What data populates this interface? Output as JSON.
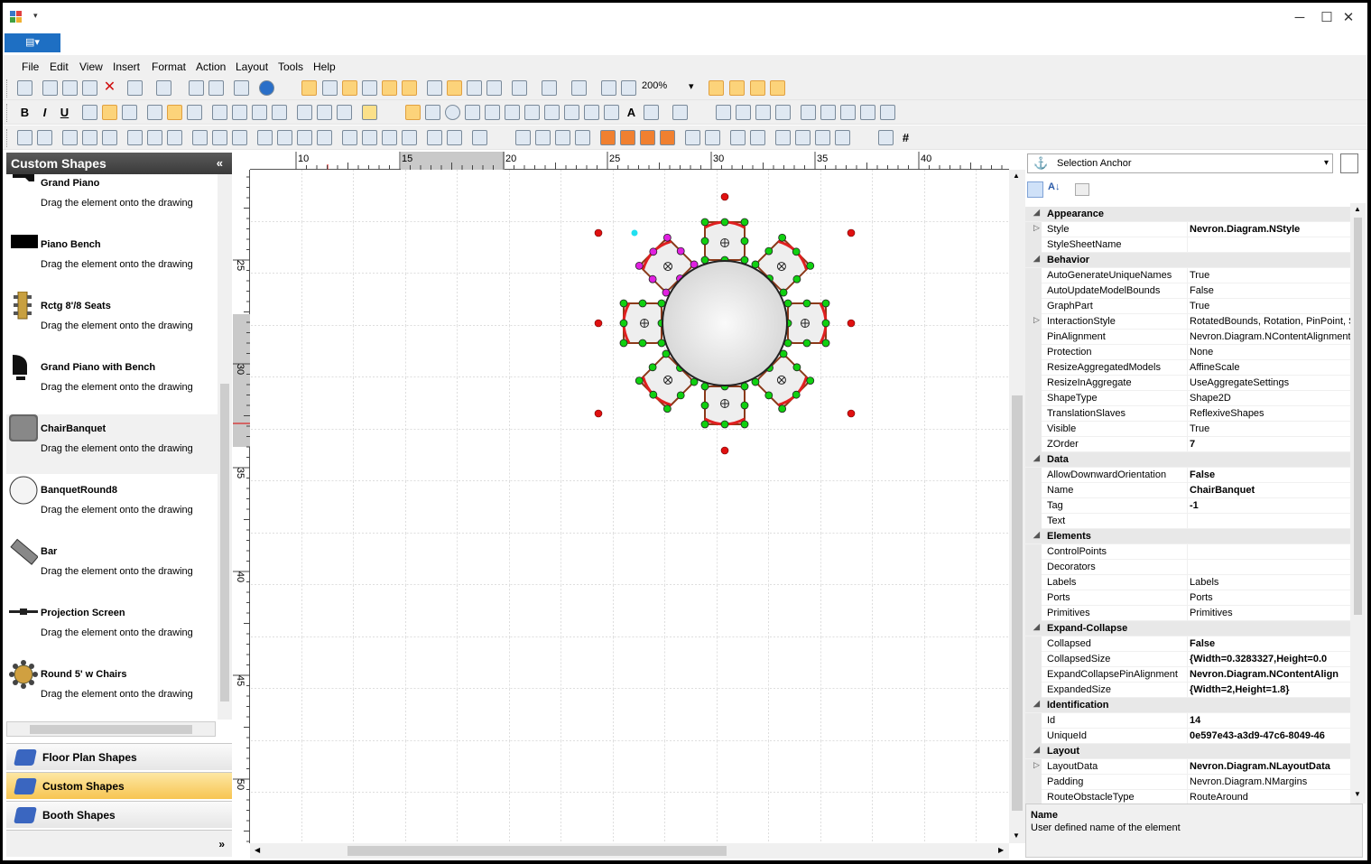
{
  "window": {
    "minimize": "─",
    "maximize": "☐",
    "close": "✕",
    "qat_arrow": "▾"
  },
  "app_button": {
    "label": "▤▾"
  },
  "menu": [
    "File",
    "Edit",
    "View",
    "Insert",
    "Format",
    "Action",
    "Layout",
    "Tools",
    "Help"
  ],
  "toolbar": {
    "zoom": "200%",
    "bold": "B",
    "italic": "I",
    "underline": "U",
    "text_tool": "A",
    "grid_glyph": "#"
  },
  "library": {
    "title": "Custom Shapes",
    "collapse": "«",
    "items": [
      {
        "name": "Grand Piano",
        "desc": "Drag the element onto the drawing",
        "icon": "grand-piano-icon"
      },
      {
        "name": "Piano Bench",
        "desc": "Drag the element onto the drawing",
        "icon": "piano-bench-icon"
      },
      {
        "name": "Rctg 8'/8 Seats",
        "desc": "Drag the element onto the drawing",
        "icon": "rect-table-icon"
      },
      {
        "name": "Grand Piano with Bench",
        "desc": "Drag the element onto the drawing",
        "icon": "grand-piano-bench-icon"
      },
      {
        "name": "ChairBanquet",
        "desc": "Drag the element onto the drawing",
        "icon": "chair-banquet-icon"
      },
      {
        "name": "BanquetRound8",
        "desc": "Drag the element onto the drawing",
        "icon": "banquet-round-icon"
      },
      {
        "name": "Bar",
        "desc": "Drag the element onto the drawing",
        "icon": "bar-icon"
      },
      {
        "name": "Projection Screen",
        "desc": "Drag the element onto the drawing",
        "icon": "projection-screen-icon"
      },
      {
        "name": "Round 5' w Chairs",
        "desc": "Drag the element onto the drawing",
        "icon": "round-table-chairs-icon"
      }
    ],
    "nav": [
      "Floor Plan Shapes",
      "Custom Shapes",
      "Booth Shapes"
    ],
    "nav_more": "»"
  },
  "ruler": {
    "h_labels": [
      "10",
      "15",
      "20",
      "25",
      "30",
      "35",
      "40"
    ],
    "v_labels": [
      "25",
      "30",
      "35",
      "40",
      "45",
      "50"
    ]
  },
  "properties": {
    "selector": "Selection Anchor",
    "sections": [
      {
        "name": "Appearance",
        "rows": [
          {
            "name": "Style",
            "value": "Nevron.Diagram.NStyle",
            "bold": true,
            "expand": true
          },
          {
            "name": "StyleSheetName",
            "value": ""
          }
        ]
      },
      {
        "name": "Behavior",
        "rows": [
          {
            "name": "AutoGenerateUniqueNames",
            "value": "True"
          },
          {
            "name": "AutoUpdateModelBounds",
            "value": "False"
          },
          {
            "name": "GraphPart",
            "value": "True"
          },
          {
            "name": "InteractionStyle",
            "value": "RotatedBounds, Rotation, PinPoint, S",
            "expand": true
          },
          {
            "name": "PinAlignment",
            "value": "Nevron.Diagram.NContentAlignment"
          },
          {
            "name": "Protection",
            "value": "None"
          },
          {
            "name": "ResizeAggregatedModels",
            "value": "AffineScale"
          },
          {
            "name": "ResizeInAggregate",
            "value": "UseAggregateSettings"
          },
          {
            "name": "ShapeType",
            "value": "Shape2D"
          },
          {
            "name": "TranslationSlaves",
            "value": "ReflexiveShapes"
          },
          {
            "name": "Visible",
            "value": "True"
          },
          {
            "name": "ZOrder",
            "value": "7",
            "bold": true
          }
        ]
      },
      {
        "name": "Data",
        "rows": [
          {
            "name": "AllowDownwardOrientation",
            "value": "False",
            "bold": true
          },
          {
            "name": "Name",
            "value": "ChairBanquet",
            "bold": true
          },
          {
            "name": "Tag",
            "value": "-1",
            "bold": true
          },
          {
            "name": "Text",
            "value": ""
          }
        ]
      },
      {
        "name": "Elements",
        "rows": [
          {
            "name": "ControlPoints",
            "value": ""
          },
          {
            "name": "Decorators",
            "value": ""
          },
          {
            "name": "Labels",
            "value": "Labels"
          },
          {
            "name": "Ports",
            "value": "Ports"
          },
          {
            "name": "Primitives",
            "value": "Primitives"
          }
        ]
      },
      {
        "name": "Expand-Collapse",
        "rows": [
          {
            "name": "Collapsed",
            "value": "False",
            "bold": true
          },
          {
            "name": "CollapsedSize",
            "value": "{Width=0.3283327,Height=0.0",
            "bold": true
          },
          {
            "name": "ExpandCollapsePinAlignment",
            "value": "Nevron.Diagram.NContentAlign",
            "bold": true
          },
          {
            "name": "ExpandedSize",
            "value": "{Width=2,Height=1.8}",
            "bold": true
          }
        ]
      },
      {
        "name": "Identification",
        "rows": [
          {
            "name": "Id",
            "value": "14",
            "bold": true
          },
          {
            "name": "UniqueId",
            "value": "0e597e43-a3d9-47c6-8049-46",
            "bold": true
          }
        ]
      },
      {
        "name": "Layout",
        "rows": [
          {
            "name": "LayoutData",
            "value": "Nevron.Diagram.NLayoutData",
            "bold": true,
            "expand": true
          },
          {
            "name": "Padding",
            "value": "Nevron.Diagram.NMargins"
          },
          {
            "name": "RouteObstacleType",
            "value": "RouteAround"
          }
        ]
      }
    ],
    "help_title": "Name",
    "help_text": "User defined name of the element"
  }
}
